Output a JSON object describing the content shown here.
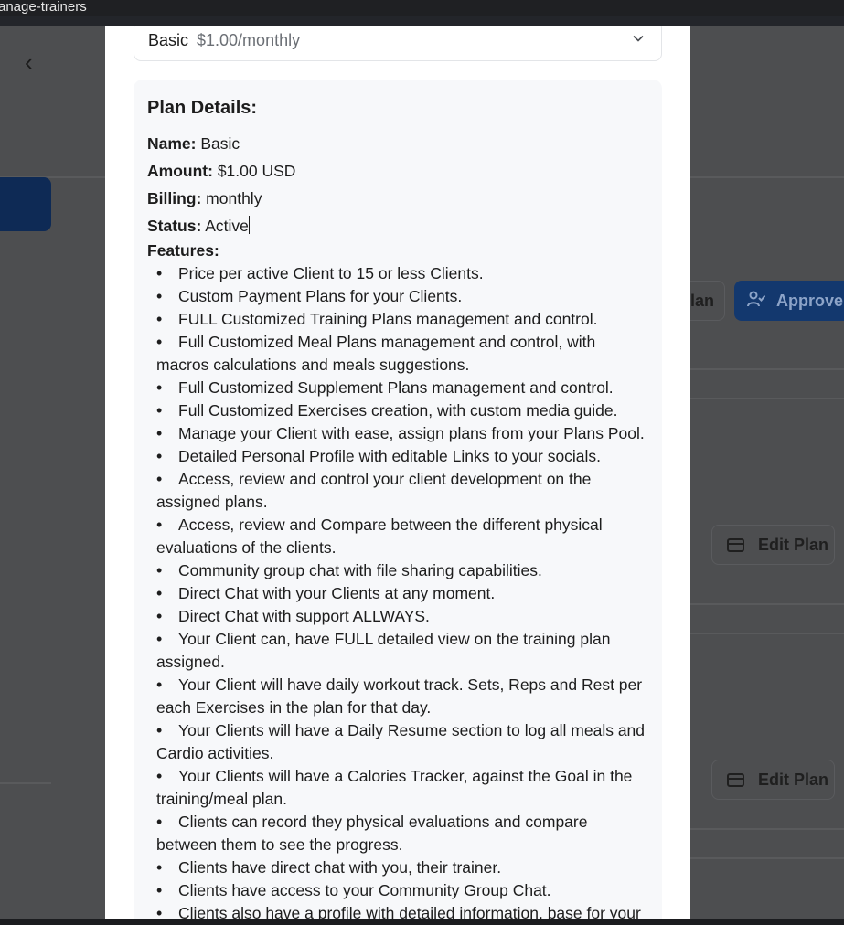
{
  "browser": {
    "tab_title": "anage-trainers"
  },
  "background": {
    "plan_button_partial": "lan",
    "approve_button_partial": "Approve",
    "edit_plan_label": "Edit Plan"
  },
  "modal": {
    "select": {
      "plan_name": "Basic",
      "plan_price": "$1.00/monthly"
    },
    "details": {
      "title": "Plan Details:",
      "name_label": "Name:",
      "name_value": "Basic",
      "amount_label": "Amount:",
      "amount_value": "$1.00 USD",
      "billing_label": "Billing:",
      "billing_value": "monthly",
      "status_label": "Status:",
      "status_value": "Active",
      "features_label": "Features:",
      "features": [
        "Price per active Client to 15 or less Clients.",
        "Custom Payment Plans for your Clients.",
        "FULL Customized Training Plans management and control.",
        "Full Customized Meal Plans management and control, with macros calculations and meals suggestions.",
        "Full Customized Supplement Plans management and control.",
        "Full Customized Exercises creation, with custom media guide.",
        "Manage your Client with ease, assign plans from your Plans Pool.",
        "Detailed Personal Profile with editable Links to your socials.",
        "Access, review and control your client development on the assigned plans.",
        "Access, review and Compare between the different physical evaluations of the clients.",
        "Community group chat with file sharing capabilities.",
        "Direct Chat with your Clients at any moment.",
        "Direct Chat with support ALLWAYS.",
        "Your Client can, have FULL detailed view on the training plan assigned.",
        "Your Client will have daily workout track. Sets, Reps and Rest per each Exercises in the plan for that day.",
        "Your Clients will have a Daily Resume section to log all meals and Cardio activities.",
        "Your Clients will have a Calories Tracker, against the Goal in the training/meal plan.",
        "Clients can record they physical evaluations and compare between them to see the progress.",
        "Clients have direct chat with you, their trainer.",
        "Clients have access to your Community Group Chat.",
        "Clients also have a profile with detailed information, base for your"
      ]
    }
  }
}
